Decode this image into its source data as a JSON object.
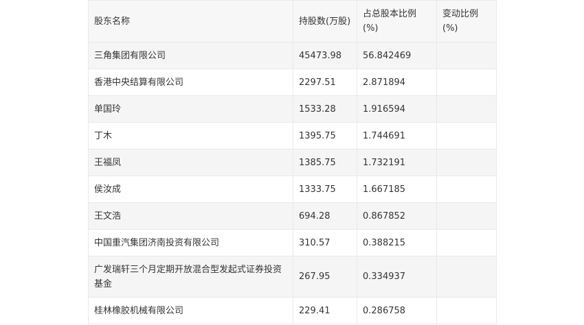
{
  "table": {
    "headers": [
      "股东名称",
      "持股数(万股)",
      "占总股本比例(%)",
      "变动比例(%)"
    ],
    "rows": [
      [
        "三角集团有限公司",
        "45473.98",
        "56.842469",
        ""
      ],
      [
        "香港中央结算有限公司",
        "2297.51",
        "2.871894",
        ""
      ],
      [
        "单国玲",
        "1533.28",
        "1.916594",
        ""
      ],
      [
        "丁木",
        "1395.75",
        "1.744691",
        ""
      ],
      [
        "王福凤",
        "1385.75",
        "1.732191",
        ""
      ],
      [
        "侯汝成",
        "1333.75",
        "1.667185",
        ""
      ],
      [
        "王文浩",
        "694.28",
        "0.867852",
        ""
      ],
      [
        "中国重汽集团济南投资有限公司",
        "310.57",
        "0.388215",
        ""
      ],
      [
        "广发瑞轩三个月定期开放混合型发起式证券投资基金",
        "267.95",
        "0.334937",
        ""
      ],
      [
        "桂林橡胶机械有限公司",
        "229.41",
        "0.286758",
        ""
      ]
    ]
  }
}
